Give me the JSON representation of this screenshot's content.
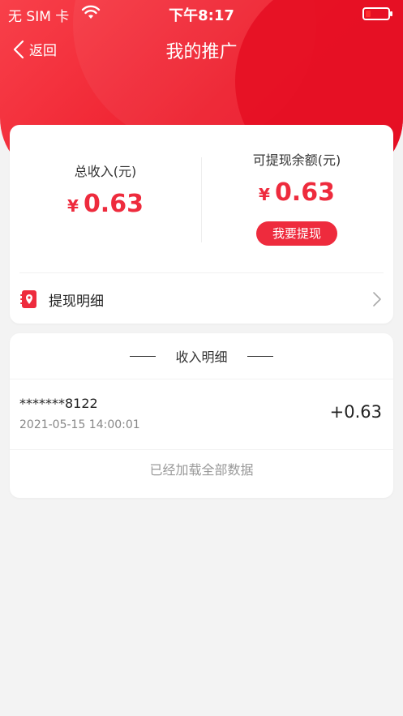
{
  "status_bar": {
    "carrier": "无 SIM 卡",
    "time": "下午8:17",
    "battery_level_fraction": 0.1
  },
  "nav": {
    "back_label": "返回",
    "title": "我的推广"
  },
  "summary": {
    "total_income_label": "总收入(元)",
    "total_income_currency": "¥",
    "total_income_value": "0.63",
    "withdrawable_label": "可提现余额(元)",
    "withdrawable_currency": "¥",
    "withdrawable_value": "0.63",
    "withdraw_button": "我要提现",
    "detail_link": "提现明细"
  },
  "income": {
    "header": "收入明细",
    "records": [
      {
        "account": "*******8122",
        "datetime": "2021-05-15 14:00:01",
        "amount": "+0.63"
      }
    ],
    "end_text": "已经加载全部数据"
  },
  "colors": {
    "accent": "#ee2b3d",
    "header_red": "#ee1f2e",
    "background": "#f3f3f3"
  },
  "icons": [
    "wifi-icon",
    "battery-icon",
    "back-chevron-icon",
    "withdraw-detail-icon",
    "chevron-right-icon"
  ]
}
